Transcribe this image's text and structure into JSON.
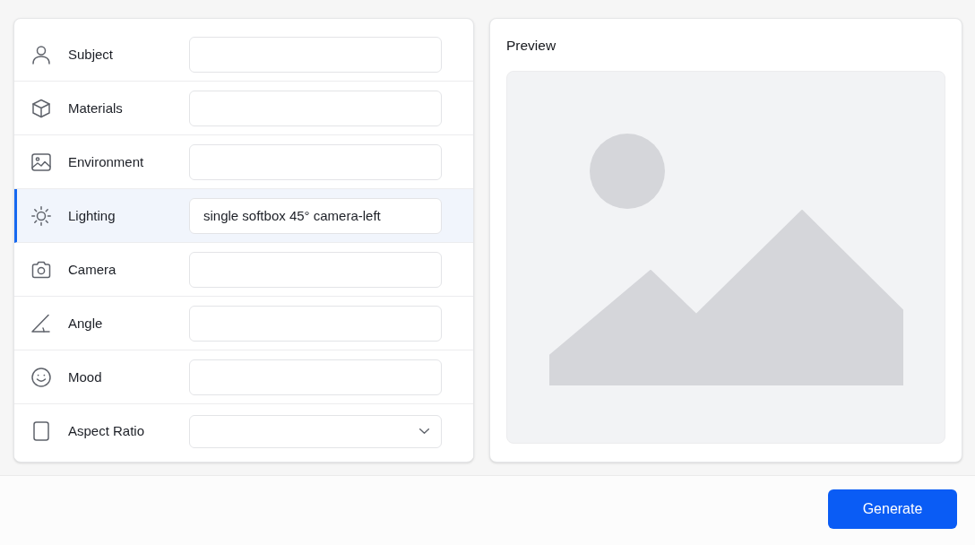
{
  "form": {
    "fields": [
      {
        "label": "Subject",
        "kind": "text",
        "selected": false
      },
      {
        "label": "Materials",
        "kind": "text",
        "selected": false
      },
      {
        "label": "Environment",
        "kind": "text",
        "selected": false
      },
      {
        "label": "Lighting",
        "kind": "text",
        "value": "single softbox 45° camera-left",
        "selected": true
      },
      {
        "label": "Camera",
        "kind": "text",
        "selected": false
      },
      {
        "label": "Angle",
        "kind": "text",
        "selected": false
      },
      {
        "label": "Mood",
        "kind": "text",
        "selected": false
      },
      {
        "label": "Aspect Ratio",
        "kind": "select",
        "selected": false
      }
    ]
  },
  "preview": {
    "title": "Preview"
  },
  "footer": {
    "buttons": [
      "Generate"
    ]
  }
}
